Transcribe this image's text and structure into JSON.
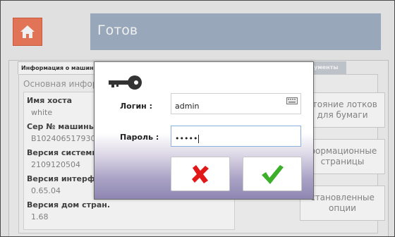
{
  "status": {
    "title": "Готов"
  },
  "tabs": {
    "machine_info": "Информация о машин",
    "right_tab": "ументы"
  },
  "section": {
    "title": "Основная инфор"
  },
  "info": [
    {
      "label": "Имя хоста",
      "value": "white"
    },
    {
      "label": "Сер № машины",
      "value": "B102406517930"
    },
    {
      "label": "Версия системы",
      "value": "2109120504"
    },
    {
      "label": "Версия интерфей",
      "value": "0.65.04"
    },
    {
      "label": "Версия дом стран.",
      "value": "1.68"
    }
  ],
  "side_buttons": {
    "tray_status": "стояние лотков для бумаги",
    "info_pages": "формационные страницы",
    "installed_options": "становленные опции"
  },
  "dialog": {
    "login_label": "Логин :",
    "login_value": "admin",
    "password_label": "Пароль :",
    "password_mask": "•••••"
  },
  "icons": {
    "home": "home-icon",
    "key": "key-icon",
    "keyboard": "keyboard-icon",
    "cancel": "red-x-icon",
    "ok": "green-check-icon"
  },
  "colors": {
    "home_button": "#f07b5c",
    "status_bar": "#a2b3c6",
    "cancel_red": "#e01818",
    "ok_green": "#3cae2a"
  }
}
